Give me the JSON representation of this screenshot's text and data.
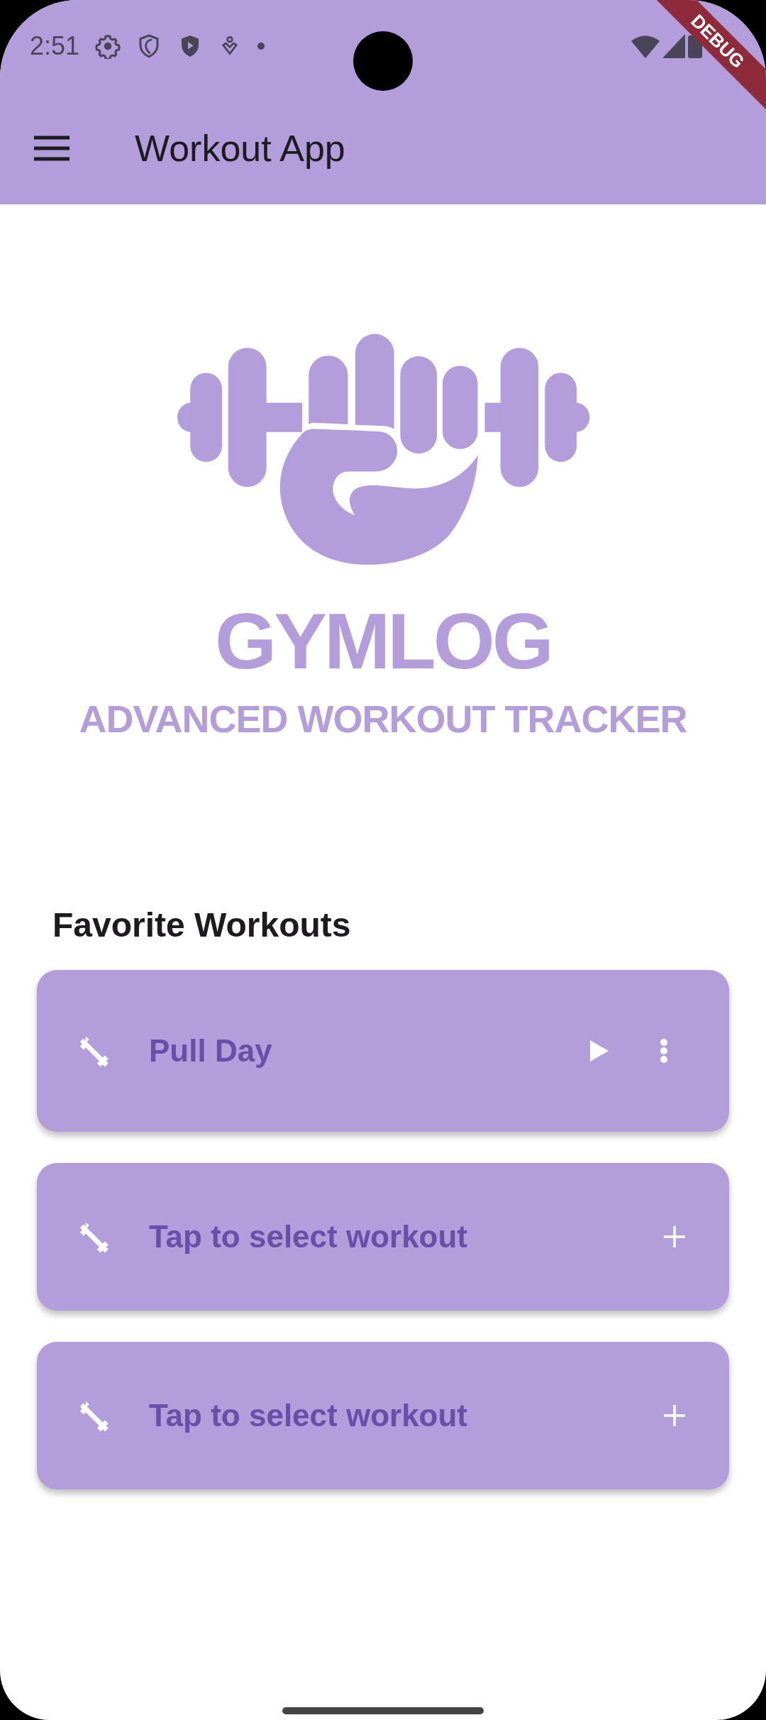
{
  "status_bar": {
    "time": "2:51"
  },
  "debug_banner": "DEBUG",
  "app_bar": {
    "title": "Workout App"
  },
  "logo": {
    "name": "GYMLOG",
    "tagline": "ADVANCED WORKOUT TRACKER"
  },
  "favorites": {
    "heading": "Favorite Workouts",
    "cards": [
      {
        "kind": "workout",
        "label": "Pull Day"
      },
      {
        "kind": "empty",
        "label": "Tap to select workout"
      },
      {
        "kind": "empty",
        "label": "Tap to select workout"
      }
    ]
  }
}
